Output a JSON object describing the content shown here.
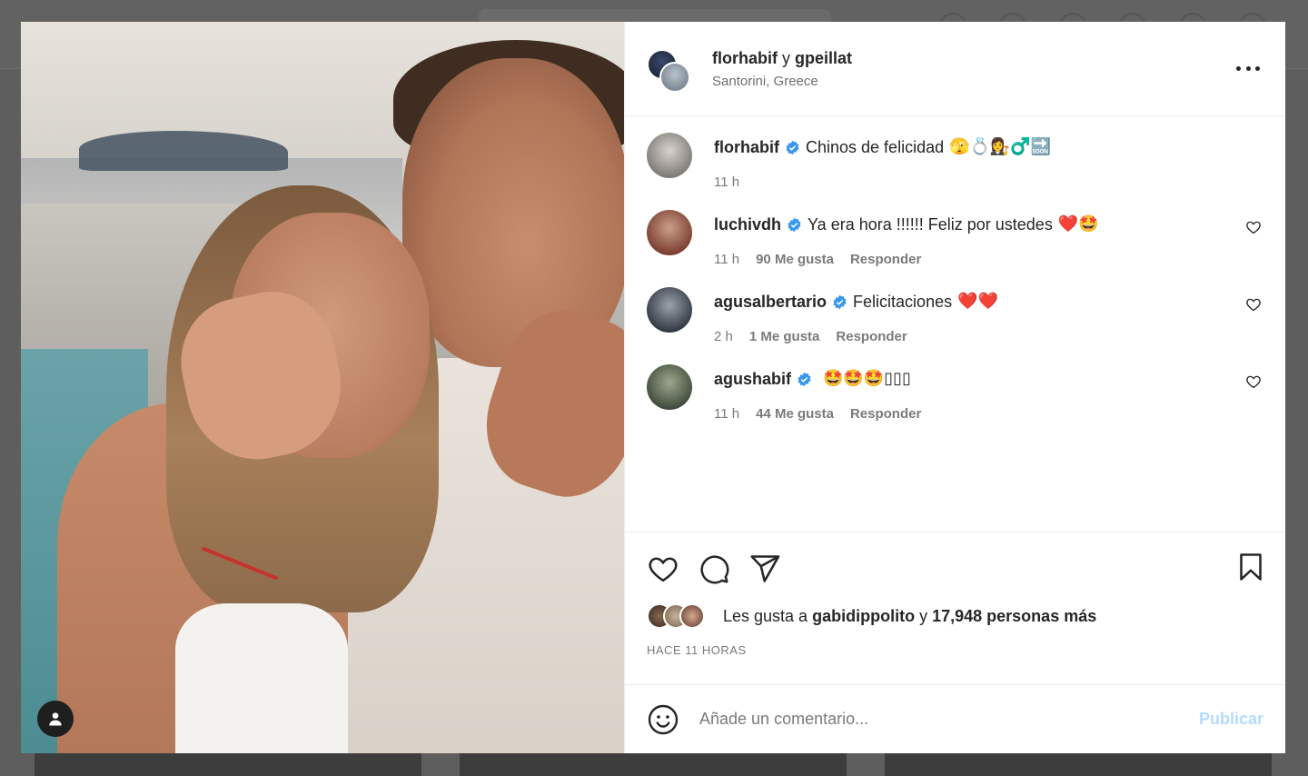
{
  "post": {
    "header": {
      "author": "florhabif",
      "connector": "y",
      "coauthor": "gpeillat",
      "location": "Santorini, Greece"
    },
    "caption": {
      "user": "florhabif",
      "text": "Chinos de felicidad",
      "emojis": "🫣💍👩‍⚖️♂️🔜",
      "time": "11 h"
    },
    "comments": [
      {
        "user": "luchivdh",
        "text": "Ya era hora !!!!!! Feliz por ustedes",
        "emojis": "❤️🤩",
        "time": "11 h",
        "likes": "90 Me gusta",
        "reply": "Responder"
      },
      {
        "user": "agusalbertario",
        "text": "Felicitaciones",
        "emojis": "❤️❤️",
        "time": "2 h",
        "likes": "1 Me gusta",
        "reply": "Responder"
      },
      {
        "user": "agushabif",
        "text": "",
        "emojis": "🤩🤩🤩▯▯▯",
        "time": "11 h",
        "likes": "44 Me gusta",
        "reply": "Responder"
      }
    ],
    "likes": {
      "prefix": "Les gusta a",
      "user": "gabidippolito",
      "connector": "y",
      "others": "17,948 personas más"
    },
    "time_ago": "HACE 11 HORAS",
    "composer": {
      "placeholder": "Añade un comentario...",
      "publish": "Publicar"
    }
  },
  "colors": {
    "verified": "#3897f0",
    "publish_disabled": "#b3dbff",
    "text": "#262626",
    "muted": "#7a7a7a"
  },
  "icons": {
    "more": "more-horizontal-icon",
    "like": "heart-icon",
    "comment": "comment-icon",
    "share": "send-icon",
    "save": "bookmark-icon",
    "emoji": "emoji-smile-icon",
    "tag": "user-tag-icon"
  }
}
